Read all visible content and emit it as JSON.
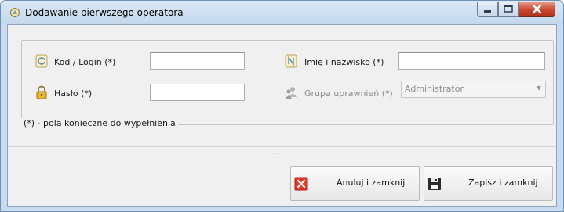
{
  "window": {
    "title": "Dodawanie pierwszego operatora"
  },
  "form": {
    "login_label": "Kod / Login (*)",
    "login_value": "",
    "password_label": "Hasło (*)",
    "password_value": "",
    "name_label": "Imię i nazwisko (*)",
    "name_value": "",
    "group_label": "Grupa uprawnień (*)",
    "group_value": "Administrator",
    "footnote": "(*) - pola konieczne do wypełnienia"
  },
  "buttons": {
    "cancel_label": "Anuluj i zamknij",
    "save_label": "Zapisz i zamknij"
  },
  "icons": {
    "title": "app-icon",
    "login": "id-card-icon",
    "password": "padlock-icon",
    "name": "name-card-icon",
    "group": "users-group-icon",
    "cancel": "red-x-icon",
    "save": "floppy-disk-icon"
  },
  "colors": {
    "title_bar": "#c3d7ec",
    "close_button": "#c9482f",
    "cancel_icon": "#e03a2b",
    "dialog_bg": "#f0f0f0"
  }
}
